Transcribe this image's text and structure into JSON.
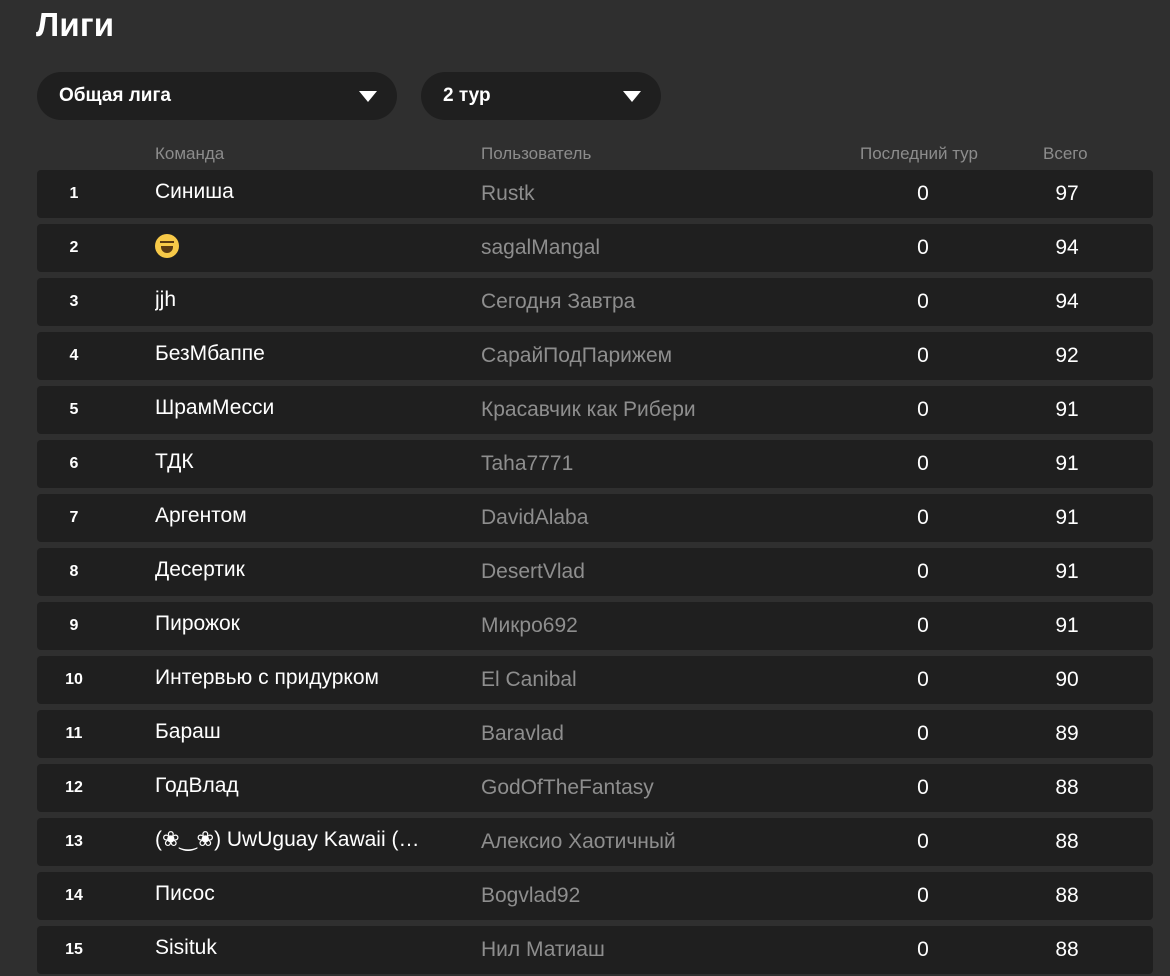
{
  "page": {
    "title": "Лиги"
  },
  "filters": {
    "league": {
      "selected": "Общая лига"
    },
    "round": {
      "selected": "2 тур"
    }
  },
  "table": {
    "columns": {
      "team": "Команда",
      "user": "Пользователь",
      "last_round": "Последний тур",
      "total": "Всего"
    },
    "rows": [
      {
        "rank": "1",
        "team": "Синиша",
        "user": "Rustk",
        "last": "0",
        "total": "97"
      },
      {
        "rank": "2",
        "team": "",
        "team_icon": "grinning-squinting-face-emoji",
        "user": "sagalMangal",
        "last": "0",
        "total": "94"
      },
      {
        "rank": "3",
        "team": "jjh",
        "user": "Сегодня Завтра",
        "last": "0",
        "total": "94"
      },
      {
        "rank": "4",
        "team": "БезМбаппе",
        "user": "СарайПодПарижем",
        "last": "0",
        "total": "92"
      },
      {
        "rank": "5",
        "team": "ШрамМесси",
        "user": "Красавчик как Рибери",
        "last": "0",
        "total": "91"
      },
      {
        "rank": "6",
        "team": "ТДК",
        "user": "Taha7771",
        "last": "0",
        "total": "91"
      },
      {
        "rank": "7",
        "team": "Аргентом",
        "user": "DavidAlaba",
        "last": "0",
        "total": "91"
      },
      {
        "rank": "8",
        "team": "Десертик",
        "user": "DesertVlad",
        "last": "0",
        "total": "91"
      },
      {
        "rank": "9",
        "team": "Пирожок",
        "user": "Микро692",
        "last": "0",
        "total": "91"
      },
      {
        "rank": "10",
        "team": "Интервью с придурком",
        "user": "El Canibal",
        "last": "0",
        "total": "90"
      },
      {
        "rank": "11",
        "team": "Бараш",
        "user": "Baravlad",
        "last": "0",
        "total": "89"
      },
      {
        "rank": "12",
        "team": "ГодВлад",
        "user": "GodOfTheFantasy",
        "last": "0",
        "total": "88"
      },
      {
        "rank": "13",
        "team": "(❀‿❀) UwUguay Kawaii (…",
        "user": "Алексио Хаотичный",
        "last": "0",
        "total": "88"
      },
      {
        "rank": "14",
        "team": "Писос",
        "user": "Bogvlad92",
        "last": "0",
        "total": "88"
      },
      {
        "rank": "15",
        "team": "Sisituk",
        "user": "Нил Матиаш",
        "last": "0",
        "total": "88"
      }
    ]
  }
}
